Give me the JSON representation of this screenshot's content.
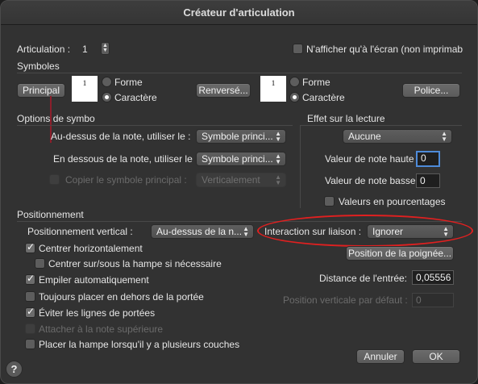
{
  "window": {
    "title": "Créateur d'articulation"
  },
  "articulation": {
    "label": "Articulation :",
    "value": "1"
  },
  "screen_only": {
    "label": "N'afficher qu'à l'écran (non imprimab",
    "checked": false
  },
  "symboles": {
    "heading": "Symboles",
    "principal_button": "Principal",
    "main_preview": "1",
    "main_radio_font": "Forme",
    "main_radio_char": "Caractère",
    "reversed_button": "Renversé...",
    "reversed_preview": "1",
    "rev_radio_font": "Forme",
    "rev_radio_char": "Caractère",
    "font_button": "Police..."
  },
  "options": {
    "heading": "Options de symbo",
    "above_label": "Au-dessus de la note, utiliser le :",
    "above_value": "Symbole princi...",
    "below_label": "En dessous de la note, utiliser le :",
    "below_value": "Symbole princi...",
    "copy_label": "Copier le symbole principal :",
    "copy_value": "Verticalement"
  },
  "playback": {
    "heading": "Effet sur la lecture",
    "effect_value": "Aucune",
    "top_label": "Valeur de note haute",
    "top_value": "0",
    "bottom_label": "Valeur de note basse",
    "bottom_value": "0",
    "percent_label": "Valeurs en pourcentages"
  },
  "positioning": {
    "heading": "Positionnement",
    "vertical_label": "Positionnement vertical :",
    "vertical_value": "Au-dessus de la n...",
    "tie_label": "Interaction sur liaison :",
    "tie_value": "Ignorer",
    "handle_button": "Position de la poignée...",
    "center_h": "Centrer horizontalement",
    "center_stem": "Centrer sur/sous la hampe si nécessaire",
    "stack": "Empiler automatiquement",
    "outside_staff": "Toujours placer en dehors de la portée",
    "avoid_lines": "Éviter les lignes de portées",
    "attach_top": "Attacher à la note supérieure",
    "stem_layers": "Placer la hampe lorsqu'il y a plusieurs couches",
    "entry_dist_label": "Distance de l'entrée:",
    "entry_dist_value": "0,05556",
    "default_vpos_label": "Position verticale par défaut :",
    "default_vpos_value": "0"
  },
  "buttons": {
    "cancel": "Annuler",
    "ok": "OK",
    "help": "?"
  },
  "icons": {
    "stepper": "up-down-stepper-icon",
    "popup": "popup-arrows-icon",
    "check": "checkmark-icon",
    "help": "question-mark-icon"
  },
  "colors": {
    "annotation_ellipse": "#e02020",
    "focus_ring": "#4e8bd9"
  }
}
